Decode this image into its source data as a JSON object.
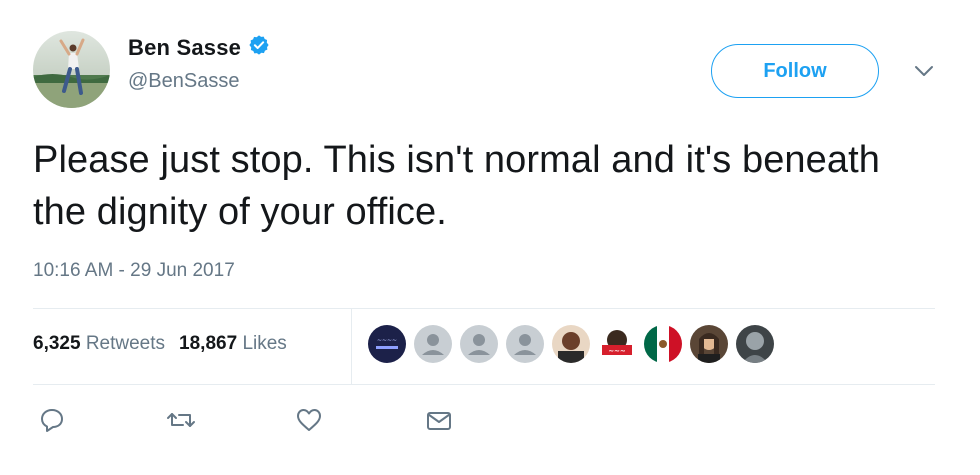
{
  "author": {
    "display_name": "Ben Sasse",
    "handle": "@BenSasse",
    "verified_icon": "verified-badge-icon"
  },
  "follow": {
    "label": "Follow"
  },
  "tweet": {
    "text": "Please just stop. This isn't normal and it's beneath the dignity of your office.",
    "timestamp": "10:16 AM - 29 Jun 2017"
  },
  "stats": {
    "retweets_count": "6,325",
    "retweets_label": "Retweets",
    "likes_count": "18,867",
    "likes_label": "Likes"
  },
  "likers_images": [
    "liker-avatar-1",
    "liker-avatar-2",
    "liker-avatar-3",
    "liker-avatar-4",
    "liker-avatar-5",
    "liker-avatar-6",
    "liker-avatar-7",
    "liker-avatar-8",
    "liker-avatar-9"
  ],
  "actions": [
    "reply-icon",
    "retweet-icon",
    "like-icon",
    "direct-message-icon"
  ],
  "colors": {
    "accent": "#1da1f2",
    "secondary_text": "#657786",
    "primary_text": "#14171a",
    "divider": "#e6ecf0"
  }
}
